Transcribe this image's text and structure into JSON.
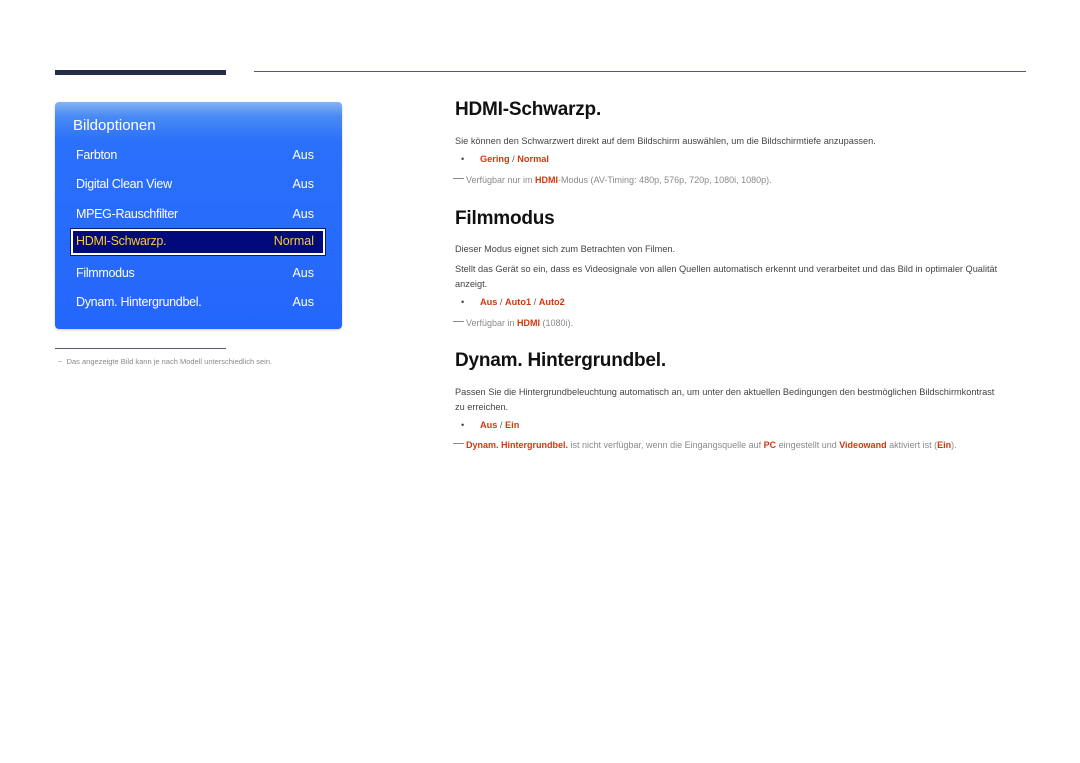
{
  "menu": {
    "title": "Bildoptionen",
    "items": [
      {
        "label": "Farbton",
        "value": "Aus"
      },
      {
        "label": "Digital Clean View",
        "value": "Aus"
      },
      {
        "label": "MPEG-Rauschfilter",
        "value": "Aus"
      },
      {
        "label": "HDMI-Schwarzp.",
        "value": "Normal",
        "selected": true
      },
      {
        "label": "Filmmodus",
        "value": "Aus"
      },
      {
        "label": "Dynam. Hintergrundbel.",
        "value": "Aus"
      }
    ],
    "colors": {
      "panel": "#2466fb",
      "selected_bg": "#000a7a",
      "selected_text": "#ffc83a"
    }
  },
  "footnote": "Das angezeigte Bild kann je nach Modell unterschiedlich sein.",
  "sections": [
    {
      "heading": "HDMI-Schwarzp.",
      "paragraphs": [
        "Sie können den Schwarzwert direkt auf dem Bildschirm auswählen, um die Bildschirmtiefe anzupassen."
      ],
      "options": [
        "Gering",
        "Normal"
      ],
      "note": {
        "pre": "Verfügbar nur im ",
        "highlight": "HDMI",
        "post": "-Modus (AV-Timing: 480p, 576p, 720p, 1080i, 1080p)."
      }
    },
    {
      "heading": "Filmmodus",
      "paragraphs": [
        "Dieser Modus eignet sich zum Betrachten von Filmen.",
        "Stellt das Gerät so ein, dass es Videosignale von allen Quellen automatisch erkennt und verarbeitet und das Bild in optimaler Qualität anzeigt."
      ],
      "options": [
        "Aus",
        "Auto1",
        "Auto2"
      ],
      "note": {
        "pre": "Verfügbar in ",
        "highlight": "HDMI",
        "post": " (1080i)."
      }
    },
    {
      "heading": "Dynam. Hintergrundbel.",
      "paragraphs": [
        "Passen Sie die Hintergrundbeleuchtung automatisch an, um unter den aktuellen Bedingungen den bestmöglichen Bildschirmkontrast zu erreichen."
      ],
      "options": [
        "Aus",
        "Ein"
      ],
      "note": {
        "h1": "Dynam. Hintergrundbel.",
        "t1": " ist nicht verfügbar, wenn die Eingangsquelle auf ",
        "h2": "PC",
        "t2": " eingestellt und ",
        "h3": "Videowand",
        "t3": " aktiviert ist (",
        "h4": "Ein",
        "t4": ")."
      }
    }
  ],
  "accent_color": "#d2380f"
}
